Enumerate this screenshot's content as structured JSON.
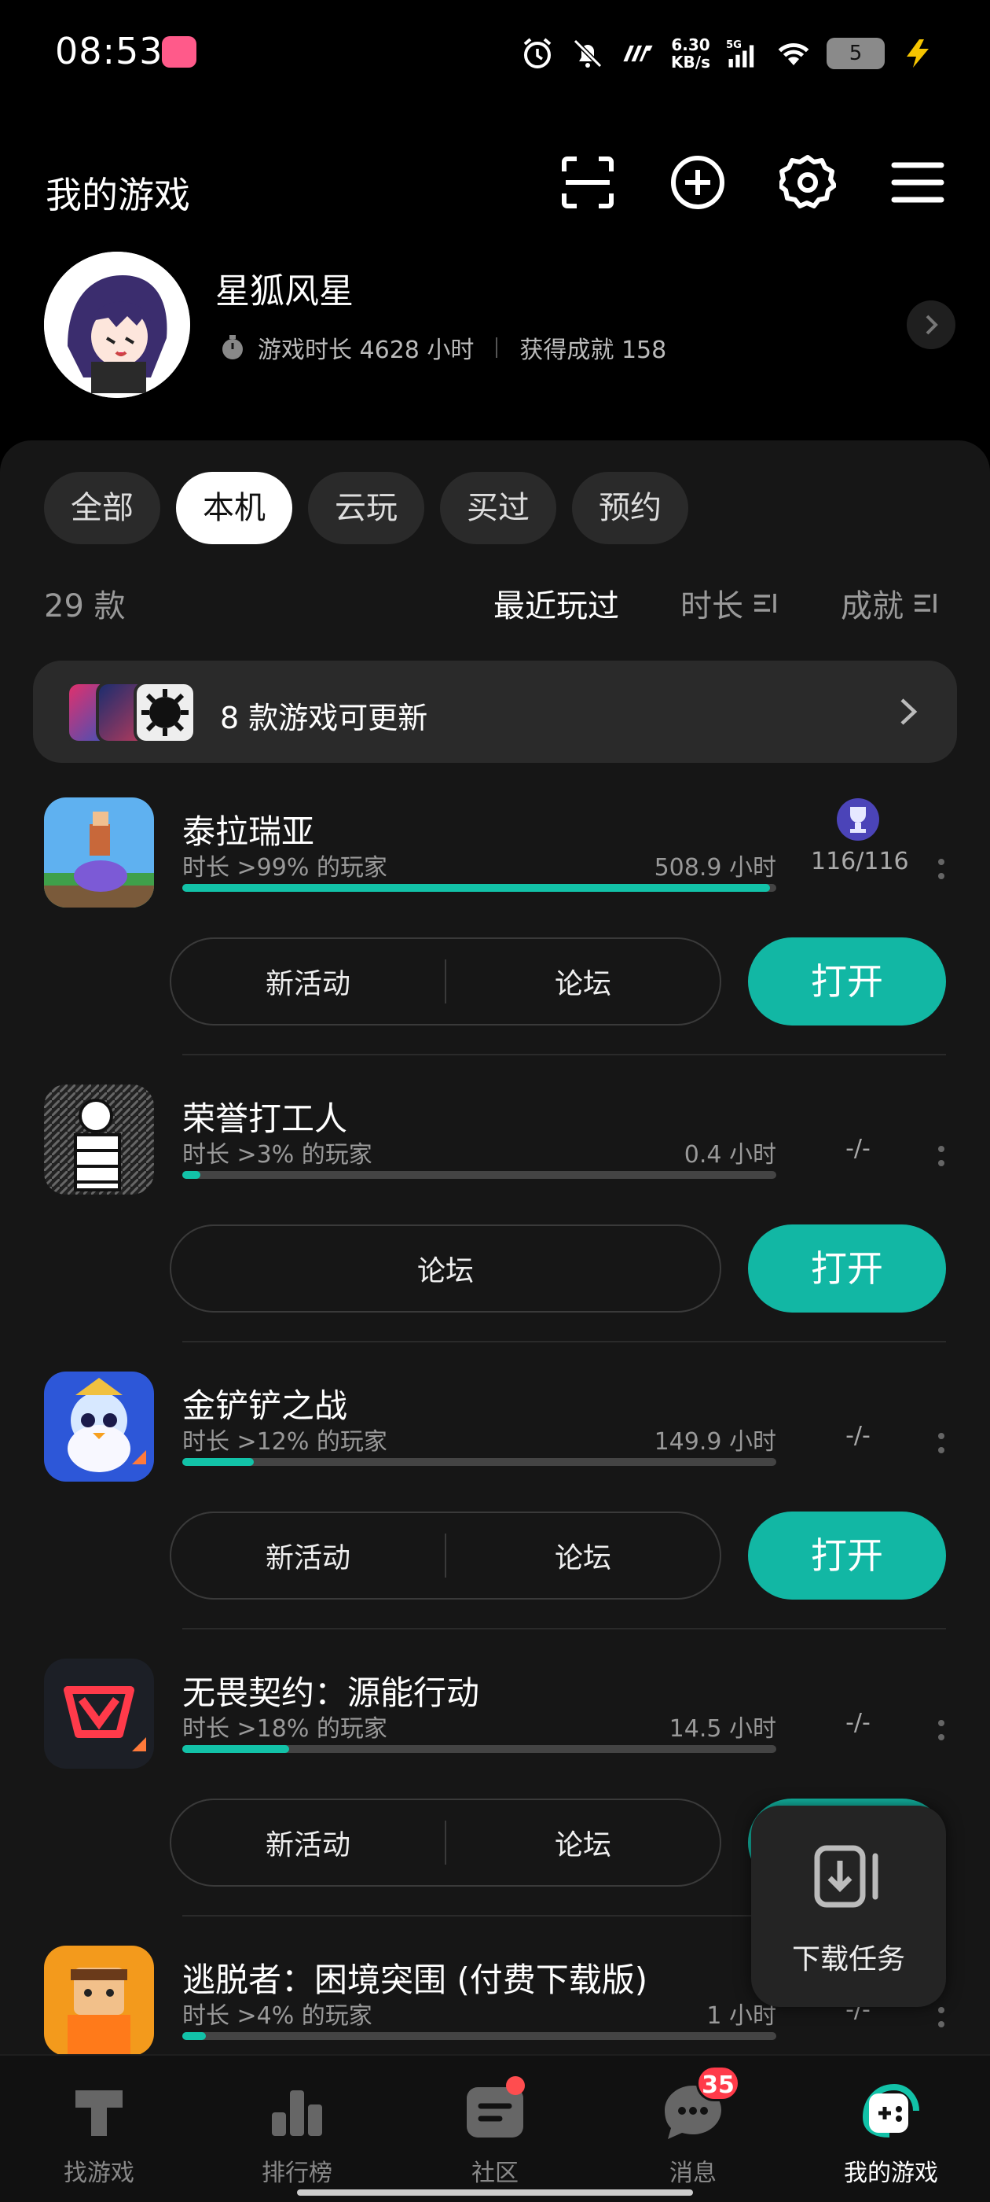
{
  "status_bar": {
    "time": "08:53",
    "net_speed_top": "6.30",
    "net_speed_unit": "KB/s",
    "signal": "5G",
    "battery": "5"
  },
  "header": {
    "title": "我的游戏"
  },
  "profile": {
    "name": "星狐风星",
    "playtime": "游戏时长 4628 小时",
    "achievements": "获得成就 158"
  },
  "tabs": [
    {
      "label": "全部",
      "active": false
    },
    {
      "label": "本机",
      "active": true
    },
    {
      "label": "云玩",
      "active": false
    },
    {
      "label": "买过",
      "active": false
    },
    {
      "label": "预约",
      "active": false
    }
  ],
  "list": {
    "count": "29 款",
    "sort_recent": "最近玩过",
    "sort_time": "时长",
    "sort_achievement": "成就"
  },
  "update_banner": {
    "text": "8 款游戏可更新"
  },
  "games": [
    {
      "name": "泰拉瑞亚",
      "rank": "时长 >99% 的玩家",
      "hours": "508.9 小时",
      "progress": 0.99,
      "achievement": "116/116",
      "has_trophy": true,
      "buttons": [
        "新活动",
        "论坛"
      ],
      "open": "打开"
    },
    {
      "name": "荣誉打工人",
      "rank": "时长 >3% 的玩家",
      "hours": "0.4 小时",
      "progress": 0.03,
      "achievement": "-/-",
      "has_trophy": false,
      "buttons": [
        "论坛"
      ],
      "open": "打开"
    },
    {
      "name": "金铲铲之战",
      "rank": "时长 >12% 的玩家",
      "hours": "149.9 小时",
      "progress": 0.12,
      "achievement": "-/-",
      "has_trophy": false,
      "buttons": [
        "新活动",
        "论坛"
      ],
      "open": "打开"
    },
    {
      "name": "无畏契约：源能行动",
      "rank": "时长 >18% 的玩家",
      "hours": "14.5 小时",
      "progress": 0.18,
      "achievement": "-/-",
      "has_trophy": false,
      "buttons": [
        "新活动",
        "论坛"
      ],
      "open": "打开"
    },
    {
      "name": "逃脱者：困境突围 (付费下载版)",
      "rank": "时长 >4% 的玩家",
      "hours": "1 小时",
      "progress": 0.04,
      "achievement": "-/-",
      "has_trophy": false,
      "buttons": [],
      "open": ""
    }
  ],
  "download_float": {
    "label": "下载任务"
  },
  "bottom_nav": [
    {
      "label": "找游戏",
      "active": false
    },
    {
      "label": "排行榜",
      "active": false
    },
    {
      "label": "社区",
      "active": false,
      "dot": true
    },
    {
      "label": "消息",
      "active": false,
      "badge": "35"
    },
    {
      "label": "我的游戏",
      "active": true
    }
  ],
  "colors": {
    "accent": "#12b7a4",
    "progress": "#12c2a8",
    "badge": "#ff3b4a"
  }
}
